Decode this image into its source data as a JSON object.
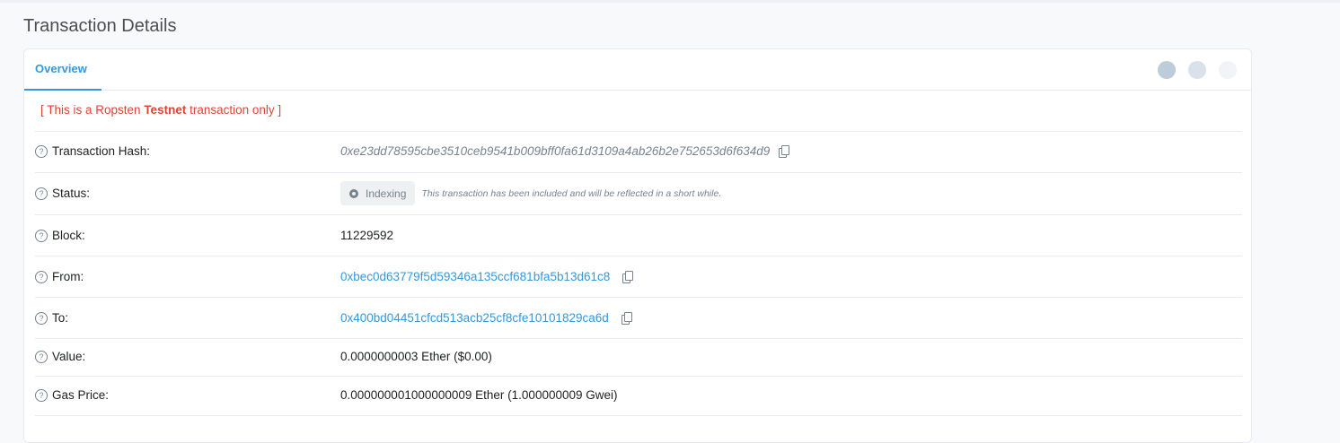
{
  "page": {
    "title": "Transaction Details"
  },
  "tabs": {
    "overview": "Overview"
  },
  "notice": {
    "prefix": "[ This is a Ropsten ",
    "bold": "Testnet",
    "suffix": " transaction only ]"
  },
  "rows": {
    "hash": {
      "label": "Transaction Hash:",
      "value": "0xe23dd78595cbe3510ceb9541b009bff0fa61d3109a4ab26b2e752653d6f634d9"
    },
    "status": {
      "label": "Status:",
      "badge": "Indexing",
      "note": "This transaction has been included and will be reflected in a short while."
    },
    "block": {
      "label": "Block:",
      "value": "11229592"
    },
    "from": {
      "label": "From:",
      "value": "0xbec0d63779f5d59346a135ccf681bfa5b13d61c8"
    },
    "to": {
      "label": "To:",
      "value": "0x400bd04451cfcd513acb25cf8cfe10101829ca6d"
    },
    "value": {
      "label": "Value:",
      "value": "0.0000000003 Ether ($0.00)"
    },
    "gas_price": {
      "label": "Gas Price:",
      "value": "0.000000001000000009 Ether (1.000000009 Gwei)"
    }
  },
  "icons": {
    "help": "question-circle-icon",
    "copy": "copy-icon",
    "status": "status-dot-icon"
  },
  "colors": {
    "accent": "#3498db",
    "notice": "#de4437",
    "muted": "#77838f"
  }
}
